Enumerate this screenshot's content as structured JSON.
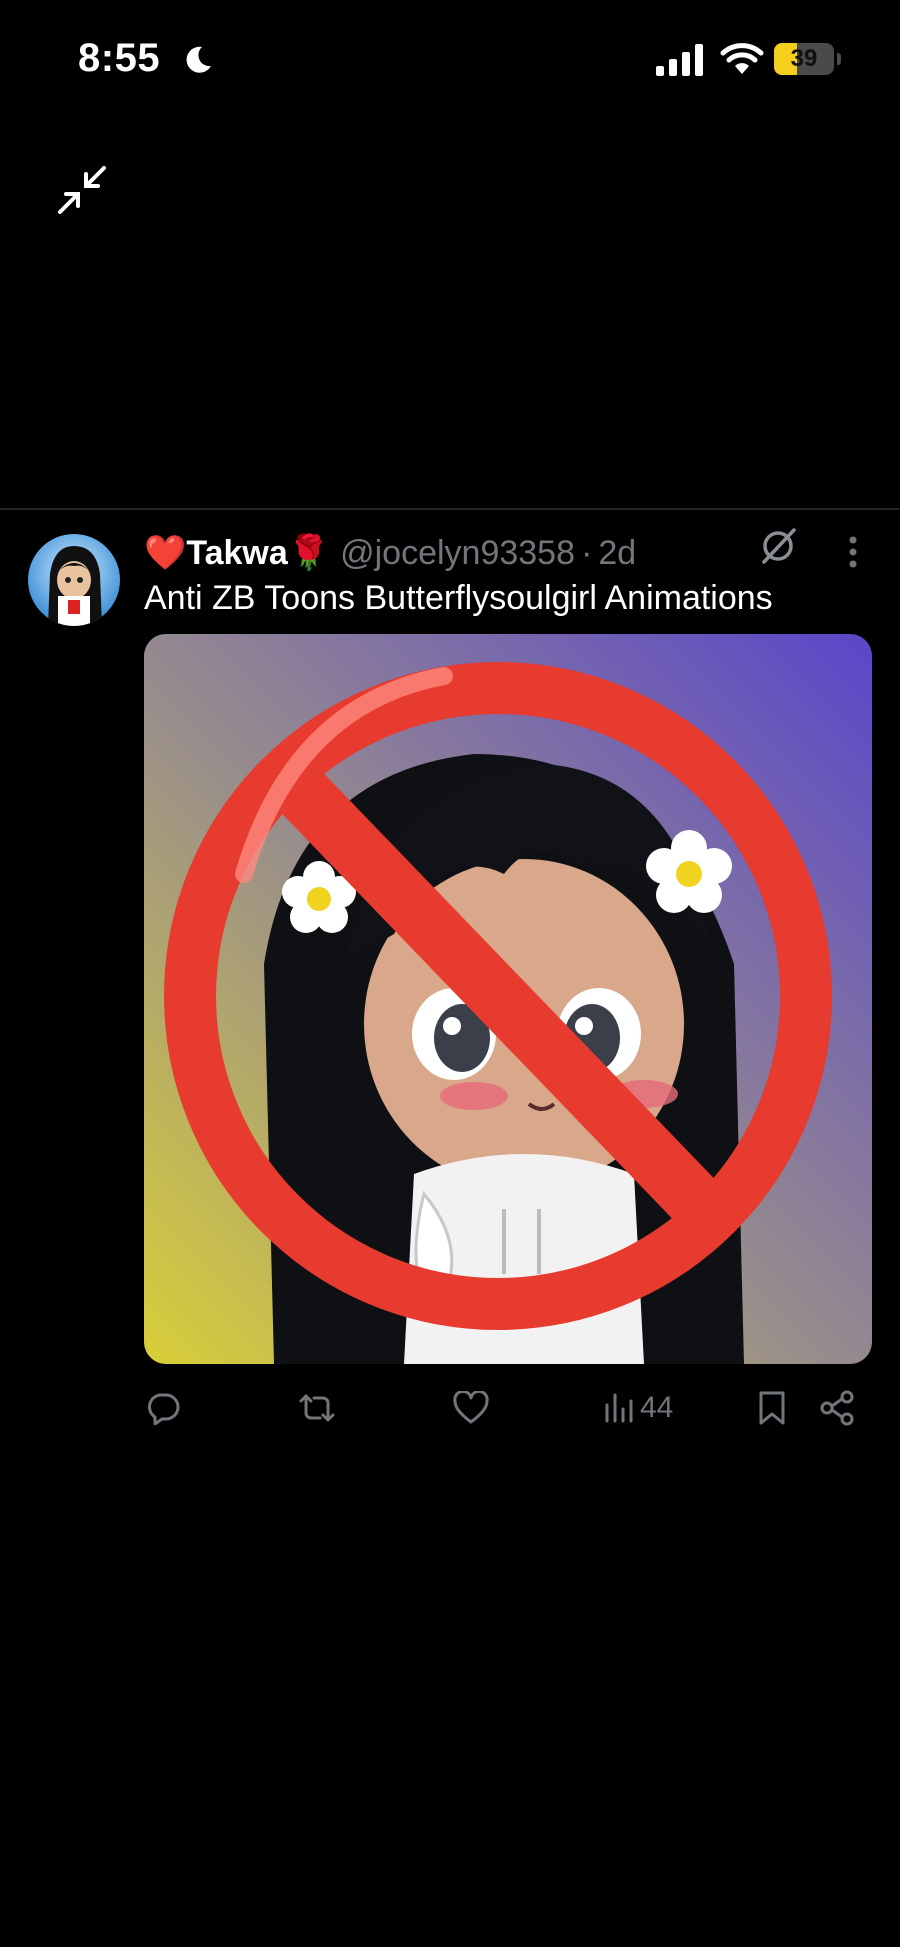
{
  "status_bar": {
    "time": "8:55",
    "battery_level": "39",
    "battery_fraction": 0.39,
    "icons": [
      "moon-icon",
      "cellular-signal-icon",
      "wifi-icon",
      "battery-icon"
    ]
  },
  "colors": {
    "background": "#000000",
    "text_primary": "#ffffff",
    "text_secondary": "#71767b",
    "battery_fill": "#f5cf1e",
    "heart": "#f91880"
  },
  "tweet": {
    "display_name": "❤️Takwa🌹",
    "handle": "@jocelyn93358",
    "separator": "·",
    "time_ago": "2d",
    "text": "Anti ZB Toons Butterflysoulgirl Animations",
    "actions": {
      "views_count": "44",
      "icons": [
        "reply-icon",
        "retweet-icon",
        "like-icon",
        "views-icon",
        "bookmark-icon",
        "share-icon"
      ]
    }
  }
}
